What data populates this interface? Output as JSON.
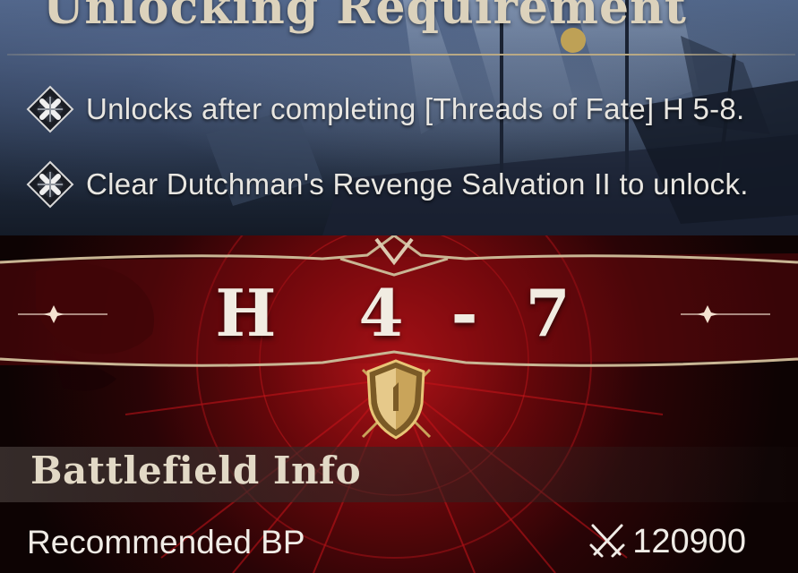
{
  "unlock": {
    "title": "Unlocking Requirement",
    "requirements": [
      "Unlocks after completing [Threads of Fate] H 5-8.",
      "Clear Dutchman's Revenge Salvation II to unlock."
    ],
    "bullet_icon": "diamond-cross-icon"
  },
  "stage": {
    "code": "H  4 - 7",
    "badge_icon": "shield-emblem-icon"
  },
  "battlefield": {
    "title": "Battlefield Info",
    "recommended_label": "Recommended BP",
    "recommended_value": "120900",
    "value_icon": "crossed-swords-icon"
  },
  "colors": {
    "top_bg": "#33435f",
    "bottom_bg": "#7a0a0e",
    "title_text": "#dcd2bc",
    "body_text": "#e8e6e1",
    "gold": "#c9a45a"
  }
}
